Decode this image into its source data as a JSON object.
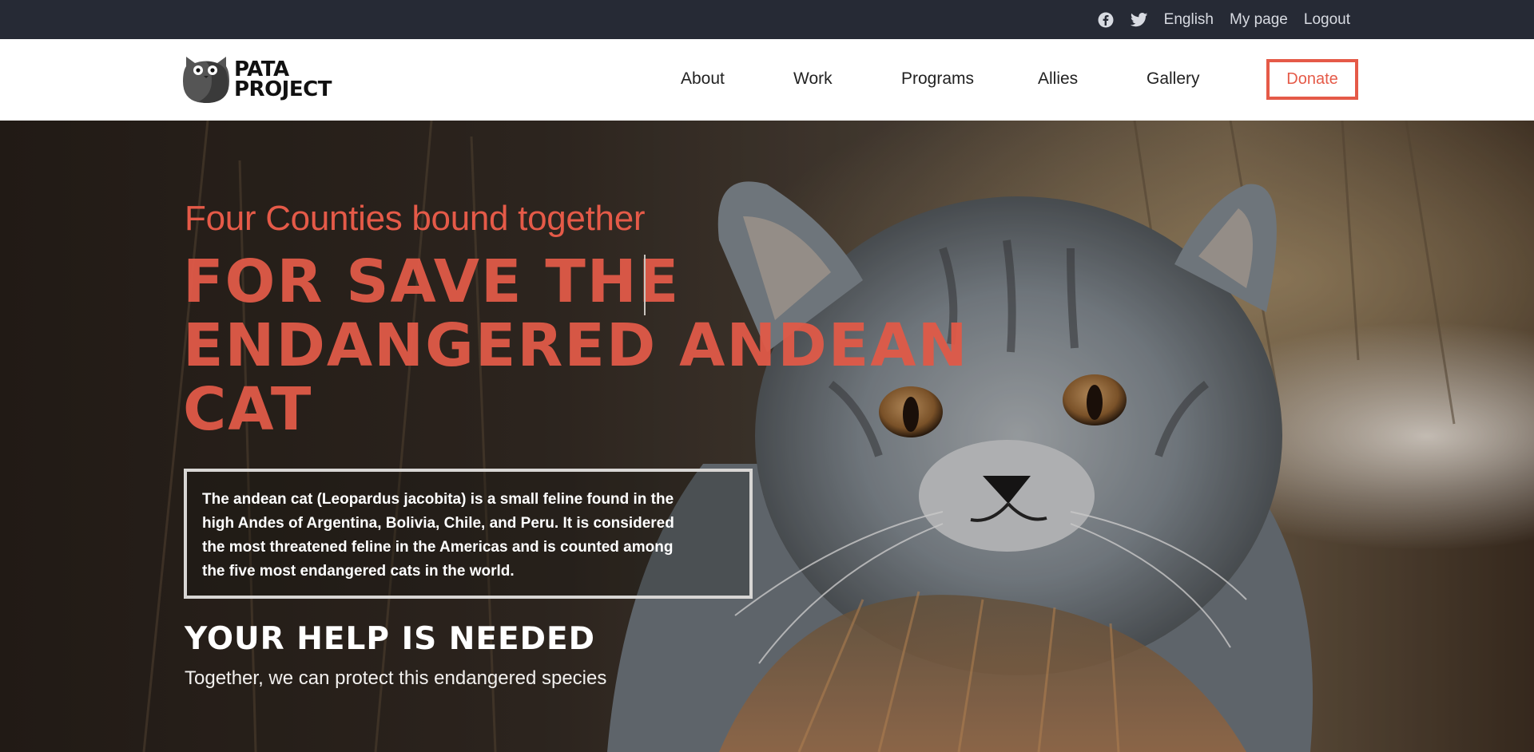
{
  "topbar": {
    "icons": [
      "facebook-icon",
      "twitter-icon"
    ],
    "language": "English",
    "my_page": "My page",
    "logout": "Logout"
  },
  "brand": {
    "line1": "PATA",
    "line2": "PROJECT"
  },
  "nav": {
    "items": [
      "About",
      "Work",
      "Programs",
      "Allies",
      "Gallery"
    ],
    "donate": "Donate"
  },
  "hero": {
    "kicker": "Four Counties bound together",
    "headline": "FOR SAVE THE ENDANGERED ANDEAN CAT",
    "description": "The andean cat (Leopardus jacobita) is a small feline found in the high Andes of Argentina, Bolivia, Chile, and Peru. It is considered the most threatened feline in the Americas and is counted among the five most endangered cats in the world.",
    "help_title": "YOUR HELP IS NEEDED",
    "help_subtitle": "Together, we can protect this endangered species"
  },
  "colors": {
    "accent": "#e55a48",
    "topbar_bg": "#262a35",
    "nav_bg": "#ffffff"
  }
}
